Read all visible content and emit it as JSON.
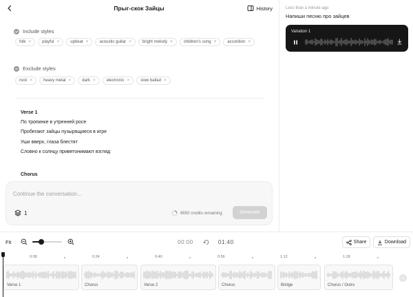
{
  "header": {
    "title": "Прыг-скок Зайцы",
    "history_label": "History"
  },
  "include_styles": {
    "label": "Include styles",
    "tags": [
      "folk",
      "playful",
      "upbeat",
      "acoustic guitar",
      "bright melody",
      "children's song",
      "accordion"
    ]
  },
  "exclude_styles": {
    "label": "Exclude styles",
    "tags": [
      "rock",
      "heavy metal",
      "dark",
      "electronic",
      "slow ballad"
    ]
  },
  "lyrics": {
    "verse_title": "Verse 1",
    "lines": [
      "По тропинке в утренней росе",
      "Пробегают зайцы пузырящиеся в игре",
      "Уши вверх, глаза блестят",
      "Словно к солнцу приветонимают взгляд"
    ],
    "next_section": "Chorus"
  },
  "composer": {
    "placeholder": "Continue the conversation...",
    "layer_count": "1",
    "credits": "8650 credits remaining",
    "generate_label": "Generate"
  },
  "history_panel": {
    "time_label": "Less than a minute ago",
    "prompt": "Напиши песню про зайцев",
    "variation_label": "Variation 1"
  },
  "timeline": {
    "fit_label": "Fit",
    "zoom_level": 0.3,
    "current_time": "00:00",
    "total_time": "01:40",
    "share_label": "Share",
    "download_label": "Download",
    "ruler": [
      "0:08",
      "0:24",
      "0:40",
      "0:56",
      "1:12",
      "1:28"
    ],
    "segments": [
      "Verse 1",
      "Chorus",
      "Verse 2",
      "Chorus",
      "Bridge",
      "Chorus / Outro"
    ]
  },
  "icons": {
    "back": "chevron-left-icon",
    "history": "history-panel-icon",
    "include": "check-circle-icon",
    "exclude": "minus-circle-icon",
    "layers": "layers-icon",
    "credits": "spinner-icon",
    "pause": "pause-icon",
    "download": "download-icon",
    "share": "share-icon",
    "zoom_out": "zoom-out-icon",
    "zoom_in": "zoom-in-icon",
    "loop": "loop-icon",
    "add": "plus-circle-icon"
  },
  "colors": {
    "accent_dark": "#161616",
    "generate_disabled": "#d2d2d2"
  }
}
